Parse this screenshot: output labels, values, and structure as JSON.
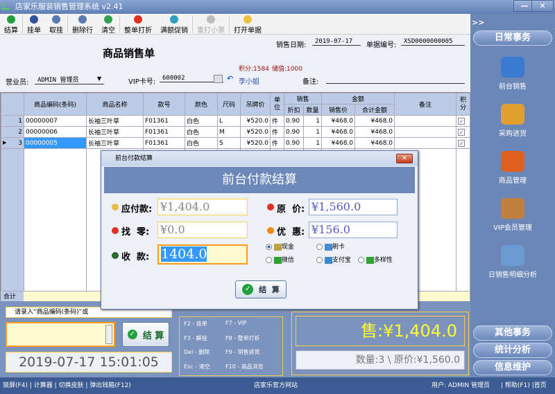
{
  "title": "店家乐服装销售管理系统 v2.41",
  "toolbar": [
    {
      "label": "结算",
      "icon": "check-icon",
      "color": "#22a040"
    },
    {
      "label": "挂单",
      "icon": "save-icon",
      "color": "#3050a0"
    },
    {
      "label": "取挂",
      "icon": "book-icon",
      "color": "#5a7ab0"
    },
    {
      "label": "删除行",
      "icon": "delete-row-icon",
      "color": "#5a7ab0"
    },
    {
      "label": "清空",
      "icon": "refresh-icon",
      "color": "#30a050"
    },
    {
      "label": "整单打折",
      "icon": "strawberry-icon",
      "color": "#e03020"
    },
    {
      "label": "满额促销",
      "icon": "gift-icon",
      "color": "#30a0c0"
    },
    {
      "label": "重打小票",
      "icon": "printer-icon",
      "color": "#bbbbbb"
    },
    {
      "label": "打开单据",
      "icon": "folder-icon",
      "color": "#f0c040"
    }
  ],
  "form": {
    "heading": "商品销售单",
    "date_label": "销售日期:",
    "date": "2019-07-17",
    "doc_label": "单据编号:",
    "doc_no": "XSD0000000005",
    "points": "积分:1584",
    "balance": "储值:1000",
    "clerk_label": "营业员:",
    "clerk": "ADMIN 管理员",
    "vip_label": "VIP卡号:",
    "vip": "600002",
    "vip_name": "李小姐",
    "note_label": "备注:"
  },
  "grid": {
    "headers": {
      "code": "商品编码(条码)",
      "name": "商品名称",
      "style": "款号",
      "color": "颜色",
      "size": "尺码",
      "tag_price": "吊牌价",
      "unit": "单位",
      "sale": "销售",
      "discount": "折扣",
      "qty": "数量",
      "amount": "金额",
      "sale_price": "销售价",
      "total": "合计金额",
      "note": "备注",
      "points": "积分"
    },
    "rows": [
      {
        "no": "1",
        "code": "00000007",
        "name": "长袖三叶草",
        "style": "F01361",
        "color": "白色",
        "size": "L",
        "tag_price": "¥520.0",
        "unit": "件",
        "discount": "0.90",
        "qty": "1",
        "sale_price": "¥468.0",
        "total": "¥468.0"
      },
      {
        "no": "2",
        "code": "00000006",
        "name": "长袖三叶草",
        "style": "F01361",
        "color": "白色",
        "size": "M",
        "tag_price": "¥520.0",
        "unit": "件",
        "discount": "0.90",
        "qty": "1",
        "sale_price": "¥468.0",
        "total": "¥468.0"
      },
      {
        "no": "3",
        "code": "00000005",
        "name": "长袖三叶草",
        "style": "F01361",
        "color": "白色",
        "size": "S",
        "tag_price": "¥520.0",
        "unit": "件",
        "discount": "0.90",
        "qty": "1",
        "sale_price": "¥468.0",
        "total": "¥468.0"
      }
    ],
    "total_label": "合计"
  },
  "bottom": {
    "hint": "请录入“商品编码(条码)”或",
    "settle": "结 算",
    "clock": "2019-07-17 15:01:05",
    "shortcuts": [
      "F2 - 挂单",
      "F7 - VIP",
      "F3 - 解挂",
      "F8 - 整单打折",
      "Del - 删除",
      "F9 - 销售退货",
      "Esc - 清空",
      "F10 - 商品浏览"
    ],
    "sale_total": "售:¥1,404.0",
    "summary": "数量:3 \\ 原价:¥1,560.0"
  },
  "sidebar": {
    "expand": ">>",
    "daily": "日常事务",
    "items": [
      "前台销售",
      "采购进货",
      "商品管理",
      "VIP会员管理",
      "日销售明细分析"
    ],
    "other": "其他事务",
    "stats": "统计分析",
    "maint": "信息维护"
  },
  "status": {
    "left": [
      "锁屏(F4)",
      "计算器",
      "切换皮肤",
      "弹出钱箱(F12)"
    ],
    "center": "店家乐官方网站",
    "user": "用户: ADMIN 管理员",
    "help": "帮助(F1)",
    "home": "首页"
  },
  "dialog": {
    "title": "前台付款结算",
    "heading": "前台付款结算",
    "payable_label": "应付款:",
    "payable": "¥1,404.0",
    "change_label": "找  零:",
    "change": "¥0.0",
    "received_label": "收  款:",
    "received": "1404.0",
    "original_label": "原  价:",
    "original": "¥1,560.0",
    "discount_label": "优  惠:",
    "discount": "¥156.0",
    "methods": [
      "现金",
      "刷卡",
      "微信",
      "支付宝",
      "多样性"
    ],
    "selected_method": "现金",
    "settle": "结  算"
  }
}
